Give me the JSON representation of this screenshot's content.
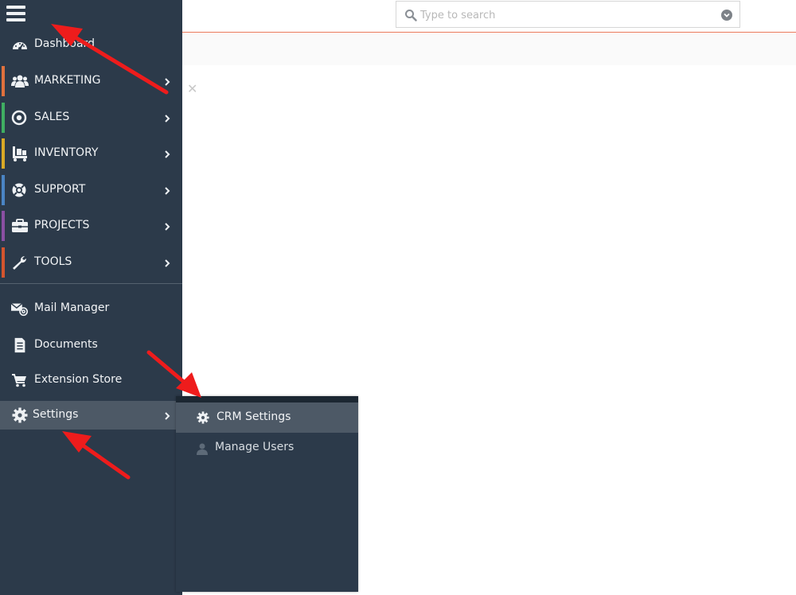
{
  "search": {
    "placeholder": "Type to search"
  },
  "sidebar": {
    "items": [
      {
        "label": "Dashboard",
        "icon": "dashboard-icon"
      },
      {
        "label": "MARKETING",
        "icon": "users-group-icon",
        "color": "#e0713d"
      },
      {
        "label": "SALES",
        "icon": "target-icon",
        "color": "#3fae62"
      },
      {
        "label": "INVENTORY",
        "icon": "dolly-icon",
        "color": "#d9a926"
      },
      {
        "label": "SUPPORT",
        "icon": "lifebuoy-icon",
        "color": "#4a84c4"
      },
      {
        "label": "PROJECTS",
        "icon": "briefcase-icon",
        "color": "#8a4fa3"
      },
      {
        "label": "TOOLS",
        "icon": "wrench-icon",
        "color": "#d4552e"
      },
      {
        "label": "Mail Manager",
        "icon": "mail-at-icon"
      },
      {
        "label": "Documents",
        "icon": "document-icon"
      },
      {
        "label": "Extension Store",
        "icon": "cart-icon"
      },
      {
        "label": "Settings",
        "icon": "gear-icon"
      }
    ]
  },
  "flyout": {
    "items": [
      {
        "label": "CRM Settings",
        "icon": "gear-icon"
      },
      {
        "label": "Manage Users",
        "icon": "user-icon"
      }
    ]
  },
  "colors": {
    "sidebar_bg": "#2c3a4a",
    "active_bg": "#4d5966",
    "header_rule": "#e8795a",
    "annotation_arrow": "#ee1c1c"
  }
}
